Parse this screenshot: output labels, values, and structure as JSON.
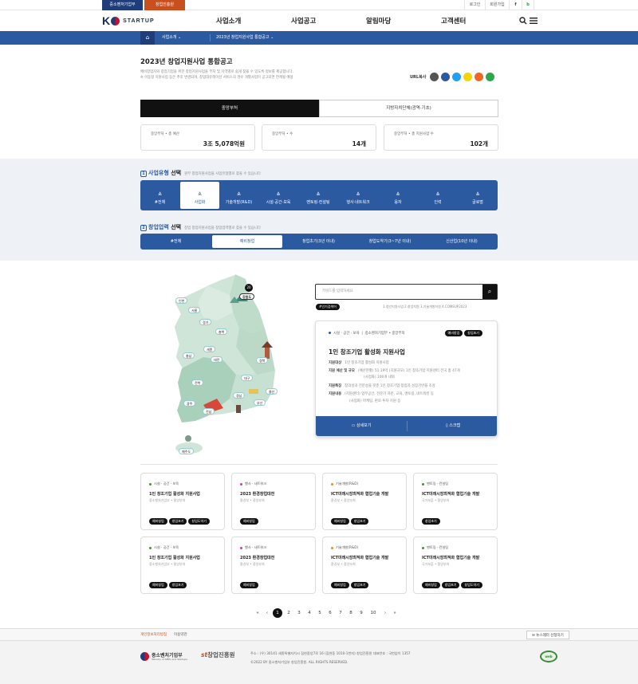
{
  "util": {
    "link1": "중소벤처기업부",
    "link2": "창업진흥원",
    "login": "로그인",
    "join": "회원가입",
    "fb": "f",
    "blog": "b"
  },
  "header": {
    "logo_text": "STARTUP",
    "nav": [
      "사업소개",
      "사업공고",
      "알림마당",
      "고객센터"
    ]
  },
  "breadcrumb": {
    "level1": "사업소개",
    "level2": "2023년 창업지원사업 통합공고"
  },
  "page": {
    "title": "2023년 창업지원사업 통합공고",
    "desc1": "예비창업자와 창업기업을 위한 창업지원사업을 부처 및 지역별로 쉽게 찾을 수 있도록 정보를 제공합니다.",
    "desc2": "※ 이동형 지원사업 등은 추후 변경되며, 창업대유레이션 서비스의 경우 개별사업이 공고되면 연계될 예정",
    "url_label": "URL복사"
  },
  "tabs": {
    "central": "중앙부처",
    "local": "지방자치단체(광역·기초)"
  },
  "stats": [
    {
      "label": "중앙부처 • 총 예산",
      "value": "3조 5,078억원"
    },
    {
      "label": "중앙부처 • 수",
      "value": "14개"
    },
    {
      "label": "중앙부처 • 총 지원사업 수",
      "value": "102개"
    }
  ],
  "section1": {
    "num": "1",
    "title_a": "사업유형",
    "title_b": "선택",
    "hint": "원부 창업지원사업을 사업유형별로 찾을 수 있습니다"
  },
  "types": [
    "#전체",
    "사업화",
    "기술개발(R&D)",
    "시설·공간·보육",
    "멘토링·컨설팅",
    "행사·네트워크",
    "융자",
    "인력",
    "글로벌"
  ],
  "section2": {
    "num": "2",
    "title_a": "창업업력",
    "title_b": "선택",
    "hint": "창업 창업지원사업을 창업업력별로 찾을 수 있습니다"
  },
  "ages": [
    "#전체",
    "예비창업",
    "창업초기(3년 이내)",
    "창업도약기(3~7년 이내)",
    "신산업(10년 이내)"
  ],
  "map": {
    "regions": [
      "인천",
      "서울",
      "경기",
      "강원도",
      "충북",
      "세종",
      "충남",
      "대전",
      "경북",
      "대구",
      "전북",
      "울산",
      "경남",
      "부산",
      "광주",
      "전남",
      "제주도"
    ],
    "selected_count": "20"
  },
  "search": {
    "placeholder": "키워드를 입력하세요",
    "popular_label": "#인기검색어",
    "popular_terms": "1.청년지원사업  2.창업지원  3.기술개발지원  4.COMEUP2023"
  },
  "feature": {
    "category": "시설 · 공간 · 보육",
    "org": "중소벤처기업부 • 중앙부처",
    "tags": [
      "예비창업",
      "창업초기"
    ],
    "title": "1인 창조기업 활성화 지원사업",
    "rows": [
      {
        "k": "지원대상",
        "v": "1인 창조기업 활성화 지원사업"
      },
      {
        "k": "지원 예산 및 규모",
        "v": "(예산현황) 51.19억 (지원규모) 1인 창조기업 지원센터 전국 총 47개"
      },
      {
        "k": "",
        "v": "(사업화) 100개 내외"
      },
      {
        "k": "지원특징",
        "v": "창의성과 전문성을 갖춘 1인 창조기업 창업과 성장기반을 조성"
      },
      {
        "k": "지원내용",
        "v": "(지원센터) 업무공간, 전문가 자문, 교육, 멘토링, 네트워킹 등"
      },
      {
        "k": "",
        "v": "(사업화) 마케팅, 판로·투자 지원 등"
      }
    ],
    "detail_btn": "상세보기",
    "scrap_btn": "스크랩"
  },
  "cards": [
    {
      "cat": "시설 · 공간 · 보육",
      "title": "1인 창조기업 활성화 지원사업",
      "org": "중소벤처기업부 • 중앙부처",
      "tags": [
        "예비창업",
        "창업초기",
        "창업도약기"
      ]
    },
    {
      "cat": "행사 · 네트워크",
      "title": "2023 환경창업대전",
      "org": "환경부 • 중앙부처",
      "tags": [
        "예비창업"
      ]
    },
    {
      "cat": "기술개발(R&D)",
      "title": "ICT미래시장최적화 협업기술 개발",
      "org": "환경부 • 중앙부처",
      "tags": [
        "예비창업",
        "창업초기"
      ]
    },
    {
      "cat": "멘토링 · 컨설팅",
      "title": "ICT미래시장최적화 협업기술 개발",
      "org": "국가보훈 • 중앙부처",
      "tags": [
        "창업초기"
      ]
    },
    {
      "cat": "시설 · 공간 · 보육",
      "title": "1인 창조기업 활성화 지원사업",
      "org": "중소벤처기업부 • 중앙부처",
      "tags": [
        "예비창업",
        "창업초기"
      ]
    },
    {
      "cat": "행사 · 네트워크",
      "title": "2023 환경창업대전",
      "org": "환경부 • 중앙부처",
      "tags": [
        "예비창업"
      ]
    },
    {
      "cat": "기술개발(R&D)",
      "title": "ICT미래시장최적화 협업기술 개발",
      "org": "환경부 • 중앙부처",
      "tags": [
        "예비창업",
        "창업초기"
      ]
    },
    {
      "cat": "멘토링 · 컨설팅",
      "title": "ICT미래시장최적화 협업기술 개발",
      "org": "국가보훈 • 중앙부처",
      "tags": [
        "예비창업",
        "창업초기",
        "창업도약기"
      ]
    }
  ],
  "pager": {
    "first": "«",
    "prev": "‹",
    "next": "›",
    "last": "»",
    "pages": [
      "1",
      "2",
      "3",
      "4",
      "5",
      "6",
      "7",
      "8",
      "9",
      "10"
    ],
    "current": "1"
  },
  "footer": {
    "privacy": "개인정보처리방침",
    "terms": "이용약관",
    "newsletter": "뉴스레터 신청하기",
    "org1": "중소벤처기업부",
    "org1_sub": "Ministry of SMEs and Startups",
    "org2": "창업진흥원",
    "address": "주소 : (우) 30141 세종특별자치시 집현중앙7로 16 (집현동 1010-1번지) 창업진흥원 대표번호 : 국번없이 1357",
    "copyright": "©2022 BY 중소벤처기업부 창업진흥원. ALL RIGHTS RESERVED.",
    "badge": "web"
  },
  "colors": {
    "primary": "#2c5aa0",
    "dark": "#111111",
    "accent": "#c8501e"
  }
}
